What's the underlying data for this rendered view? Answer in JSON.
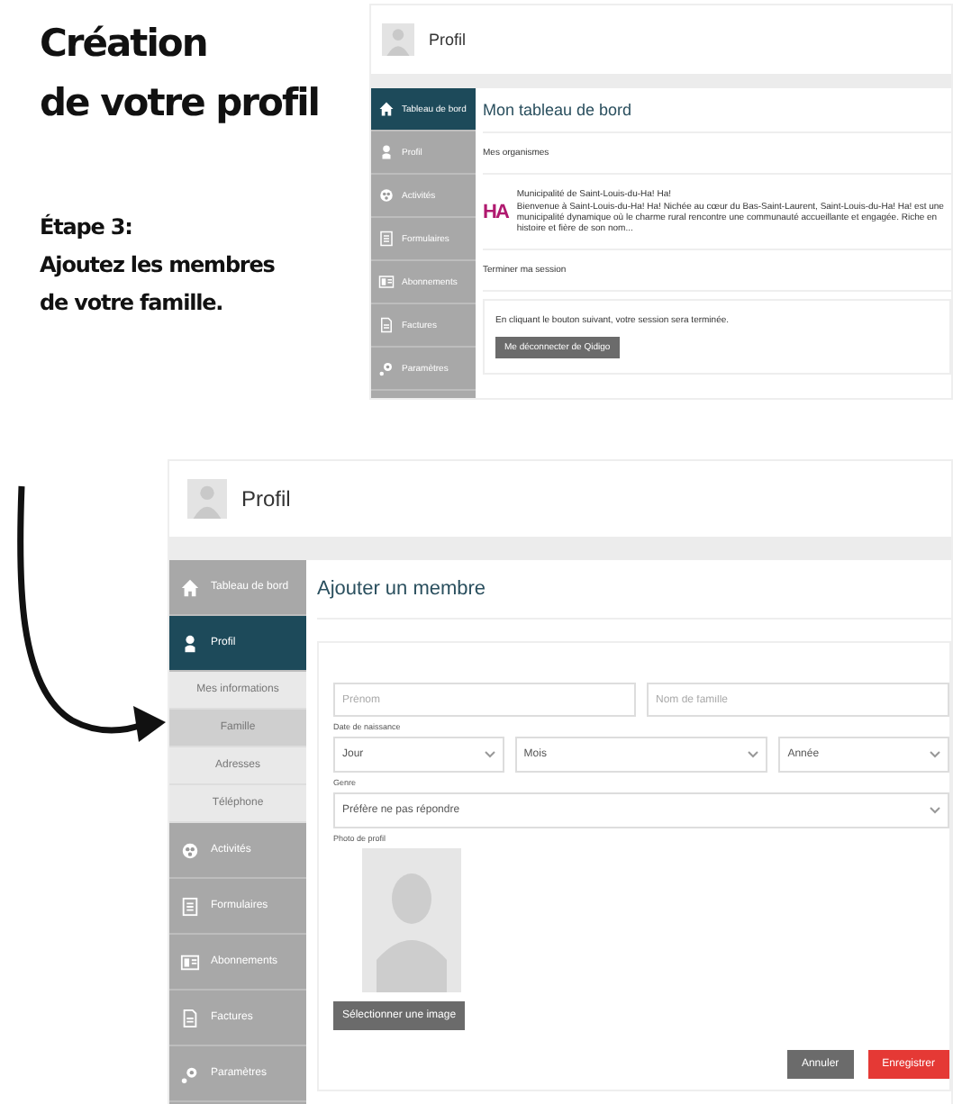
{
  "heading": {
    "lines": [
      "Création",
      "de votre profil"
    ]
  },
  "step": {
    "label": "Étape 3:",
    "lines": [
      "Ajoutez les membres",
      "de votre famille."
    ]
  },
  "dashboard_screenshot": {
    "header_title": "Profil",
    "sidebar": [
      {
        "kind": "home",
        "label": "Tableau de bord",
        "selected": true
      },
      {
        "kind": "person",
        "label": "Profil",
        "selected": false
      },
      {
        "kind": "ball",
        "label": "Activités",
        "selected": false
      },
      {
        "kind": "form",
        "label": "Formulaires",
        "selected": false
      },
      {
        "kind": "card",
        "label": "Abonnements",
        "selected": false
      },
      {
        "kind": "document",
        "label": "Factures",
        "selected": false
      },
      {
        "kind": "gear",
        "label": "Paramètres",
        "selected": false
      }
    ],
    "page_title": "Mon tableau de bord",
    "organisations_heading": "Mes organismes",
    "organisation": {
      "logo_text": "HA",
      "name": "Municipalité de Saint-Louis-du-Ha! Ha!",
      "description": "Bienvenue à Saint-Louis-du-Ha! Ha! Nichée au cœur du Bas-Saint-Laurent, Saint-Louis-du-Ha! Ha! est une municipalité dynamique où le charme rural rencontre une communauté accueillante et engagée. Riche en histoire et fière de son nom..."
    },
    "session_heading": "Terminer ma session",
    "session_text": "En cliquant le bouton suivant, votre session sera terminée.",
    "logout_button": "Me déconnecter de Qidigo"
  },
  "form_screenshot": {
    "header_title": "Profil",
    "sidebar": [
      {
        "kind": "home",
        "label": "Tableau de bord",
        "selected": false
      },
      {
        "kind": "person",
        "label": "Profil",
        "selected": true,
        "children": [
          {
            "label": "Mes informations",
            "selected": false
          },
          {
            "label": "Famille",
            "selected": true
          },
          {
            "label": "Adresses",
            "selected": false
          },
          {
            "label": "Téléphone",
            "selected": false
          }
        ]
      },
      {
        "kind": "ball",
        "label": "Activités",
        "selected": false
      },
      {
        "kind": "form",
        "label": "Formulaires",
        "selected": false
      },
      {
        "kind": "card",
        "label": "Abonnements",
        "selected": false
      },
      {
        "kind": "document",
        "label": "Factures",
        "selected": false
      },
      {
        "kind": "gear",
        "label": "Paramètres",
        "selected": false
      }
    ],
    "page_title": "Ajouter un membre",
    "first_name": {
      "placeholder": "Prénom"
    },
    "last_name": {
      "placeholder": "Nom de famille"
    },
    "birth_date": {
      "label": "Date de naissance",
      "day": {
        "value": "Jour"
      },
      "month": {
        "value": "Mois"
      },
      "year": {
        "value": "Année"
      }
    },
    "gender": {
      "label": "Genre",
      "value": "Préfère ne pas répondre"
    },
    "photo": {
      "label": "Photo de profil",
      "button": "Sélectionner une image"
    },
    "buttons": [
      {
        "kind": "secondary",
        "label": "Annuler"
      },
      {
        "kind": "primary",
        "label": "Enregistrer"
      }
    ]
  }
}
